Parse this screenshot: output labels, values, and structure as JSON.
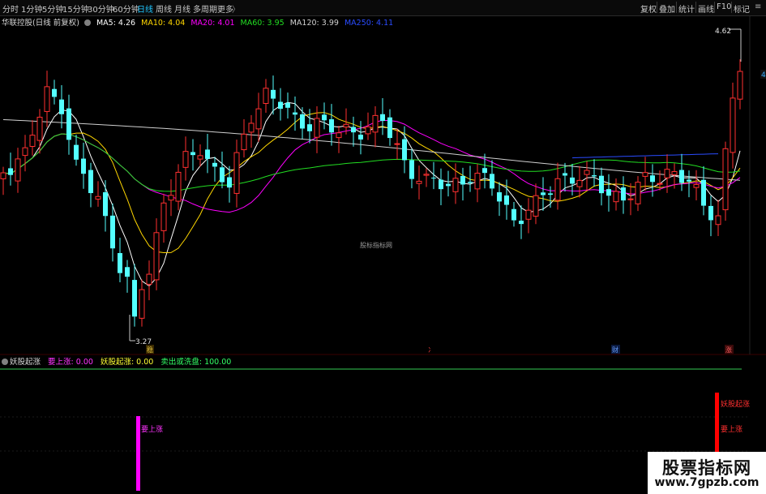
{
  "toolbar": {
    "periods": [
      "分时",
      "1分钟",
      "5分钟",
      "15分钟",
      "30分钟",
      "60分钟",
      "日线",
      "周线",
      "月线",
      "多周期",
      "更多"
    ],
    "active_period": "日线",
    "more_arrow": "〉",
    "buttons": [
      "复权",
      "叠加",
      "统计",
      "画线",
      "F10",
      "标记"
    ],
    "menu_icon": "≡"
  },
  "stock": {
    "name": "华联控股(日线 前复权)",
    "ma": [
      {
        "label": "MA5: 4.26",
        "color": "#ffffff"
      },
      {
        "label": "MA10: 4.04",
        "color": "#ffd700"
      },
      {
        "label": "MA20: 4.01",
        "color": "#ff00ff"
      },
      {
        "label": "MA60: 3.95",
        "color": "#22dd22"
      },
      {
        "label": "MA120: 3.99",
        "color": "#cfcfcf"
      },
      {
        "label": "MA250: 4.11",
        "color": "#2a4cff"
      }
    ]
  },
  "price_markers": {
    "high": "4.62",
    "low": "3.27",
    "right_edge": "4"
  },
  "center_watermark": "股标指标网",
  "event_marks": [
    {
      "text": "稳",
      "color": "#e0c040"
    },
    {
      "text": "冫",
      "color": "#ff4040"
    },
    {
      "text": "财",
      "color": "#6aa0ff"
    },
    {
      "text": "涨",
      "color": "#ff6060"
    }
  ],
  "indicator": {
    "name": "妖股起涨",
    "values": [
      {
        "label": "要上涨: 0.00",
        "color": "#ff33ff"
      },
      {
        "label": "妖股起涨: 0.00",
        "color": "#ffff33"
      },
      {
        "label": "卖出或洗盘: 100.00",
        "color": "#33ff66"
      }
    ],
    "signal_labels": {
      "up": "要上涨",
      "yao": "妖股起涨"
    }
  },
  "site_watermark": {
    "title": "股票指标网",
    "url": "www.7gpzb.com"
  },
  "chart_data": {
    "type": "candlestick",
    "y_range": [
      3.2,
      4.75
    ],
    "high_point": 4.62,
    "low_point": 3.27,
    "candle_count": 102,
    "ma_series": [
      {
        "name": "MA5",
        "color": "#ffffff"
      },
      {
        "name": "MA10",
        "color": "#ffd700"
      },
      {
        "name": "MA20",
        "color": "#ff00ff"
      },
      {
        "name": "MA60",
        "color": "#22dd22"
      },
      {
        "name": "MA120",
        "color": "#cfcfcf"
      },
      {
        "name": "MA250",
        "color": "#2a4cff"
      }
    ],
    "ma_values_last": [
      4.26,
      4.04,
      4.01,
      3.95,
      3.99,
      4.11
    ],
    "indicator_signals": [
      {
        "name": "要上涨",
        "candle_index": 19,
        "color": "#ff00ff"
      },
      {
        "name": "妖股起涨",
        "candle_index": 100,
        "color": "#ff0000"
      }
    ],
    "indicator_values": [
      0.0,
      0.0,
      100.0
    ]
  }
}
